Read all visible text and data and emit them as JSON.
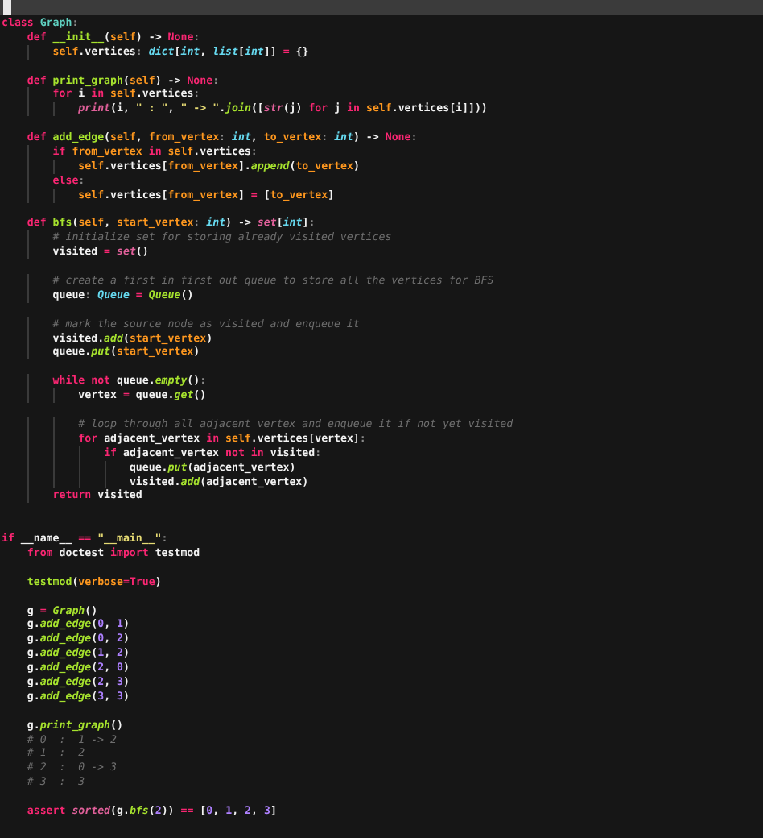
{
  "editor": {
    "lines": [
      {
        "kind": "code",
        "tokens": [
          {
            "text": "class ",
            "kind": "kw"
          },
          {
            "text": "Graph",
            "kind": "cls"
          },
          {
            "text": ":",
            "kind": "punct"
          }
        ]
      },
      {
        "kind": "code",
        "tokens": [
          {
            "text": "    def ",
            "kind": "kw"
          },
          {
            "text": "__init__",
            "kind": "fn"
          },
          {
            "text": "(",
            "kind": "plain"
          },
          {
            "text": "self",
            "kind": "self"
          },
          {
            "text": ") -> ",
            "kind": "plain"
          },
          {
            "text": "None",
            "kind": "kw"
          },
          {
            "text": ":",
            "kind": "punct"
          }
        ]
      },
      {
        "kind": "code",
        "tokens": [
          {
            "text": "        self",
            "kind": "self"
          },
          {
            "text": ".vertices",
            "kind": "plain"
          },
          {
            "text": ": ",
            "kind": "punct"
          },
          {
            "text": "dict",
            "kind": "type"
          },
          {
            "text": "[",
            "kind": "plain"
          },
          {
            "text": "int",
            "kind": "type"
          },
          {
            "text": ", ",
            "kind": "plain"
          },
          {
            "text": "list",
            "kind": "type"
          },
          {
            "text": "[",
            "kind": "plain"
          },
          {
            "text": "int",
            "kind": "type"
          },
          {
            "text": "]] ",
            "kind": "plain"
          },
          {
            "text": "=",
            "kind": "op"
          },
          {
            "text": " {}",
            "kind": "plain"
          }
        ]
      },
      {
        "kind": "blank"
      },
      {
        "kind": "code",
        "tokens": [
          {
            "text": "    def ",
            "kind": "kw"
          },
          {
            "text": "print_graph",
            "kind": "fn"
          },
          {
            "text": "(",
            "kind": "plain"
          },
          {
            "text": "self",
            "kind": "self"
          },
          {
            "text": ") -> ",
            "kind": "plain"
          },
          {
            "text": "None",
            "kind": "kw"
          },
          {
            "text": ":",
            "kind": "punct"
          }
        ]
      },
      {
        "kind": "code",
        "tokens": [
          {
            "text": "        for",
            "kind": "kw"
          },
          {
            "text": " i ",
            "kind": "plain"
          },
          {
            "text": "in ",
            "kind": "kw"
          },
          {
            "text": "self",
            "kind": "self"
          },
          {
            "text": ".vertices",
            "kind": "plain"
          },
          {
            "text": ":",
            "kind": "punct"
          }
        ]
      },
      {
        "kind": "code",
        "tokens": [
          {
            "text": "            print",
            "kind": "builtin"
          },
          {
            "text": "(i, ",
            "kind": "plain"
          },
          {
            "text": "\" : \"",
            "kind": "str"
          },
          {
            "text": ", ",
            "kind": "plain"
          },
          {
            "text": "\" -> \"",
            "kind": "str"
          },
          {
            "text": ".",
            "kind": "plain"
          },
          {
            "text": "join",
            "kind": "call"
          },
          {
            "text": "([",
            "kind": "plain"
          },
          {
            "text": "str",
            "kind": "builtin"
          },
          {
            "text": "(j) ",
            "kind": "plain"
          },
          {
            "text": "for",
            "kind": "kw"
          },
          {
            "text": " j ",
            "kind": "plain"
          },
          {
            "text": "in ",
            "kind": "kw"
          },
          {
            "text": "self",
            "kind": "self"
          },
          {
            "text": ".vertices[i]]))",
            "kind": "plain"
          }
        ]
      },
      {
        "kind": "blank"
      },
      {
        "kind": "code",
        "tokens": [
          {
            "text": "    def ",
            "kind": "kw"
          },
          {
            "text": "add_edge",
            "kind": "fn"
          },
          {
            "text": "(",
            "kind": "plain"
          },
          {
            "text": "self",
            "kind": "self"
          },
          {
            "text": ", ",
            "kind": "plain"
          },
          {
            "text": "from_vertex",
            "kind": "param"
          },
          {
            "text": ": ",
            "kind": "punct"
          },
          {
            "text": "int",
            "kind": "type"
          },
          {
            "text": ", ",
            "kind": "plain"
          },
          {
            "text": "to_vertex",
            "kind": "param"
          },
          {
            "text": ": ",
            "kind": "punct"
          },
          {
            "text": "int",
            "kind": "type"
          },
          {
            "text": ") -> ",
            "kind": "plain"
          },
          {
            "text": "None",
            "kind": "kw"
          },
          {
            "text": ":",
            "kind": "punct"
          }
        ]
      },
      {
        "kind": "code",
        "tokens": [
          {
            "text": "        if ",
            "kind": "kw"
          },
          {
            "text": "from_vertex ",
            "kind": "param"
          },
          {
            "text": "in ",
            "kind": "kw"
          },
          {
            "text": "self",
            "kind": "self"
          },
          {
            "text": ".vertices",
            "kind": "plain"
          },
          {
            "text": ":",
            "kind": "punct"
          }
        ]
      },
      {
        "kind": "code",
        "tokens": [
          {
            "text": "            self",
            "kind": "self"
          },
          {
            "text": ".vertices[",
            "kind": "plain"
          },
          {
            "text": "from_vertex",
            "kind": "param"
          },
          {
            "text": "].",
            "kind": "plain"
          },
          {
            "text": "append",
            "kind": "call"
          },
          {
            "text": "(",
            "kind": "plain"
          },
          {
            "text": "to_vertex",
            "kind": "param"
          },
          {
            "text": ")",
            "kind": "plain"
          }
        ]
      },
      {
        "kind": "code",
        "tokens": [
          {
            "text": "        else",
            "kind": "kw"
          },
          {
            "text": ":",
            "kind": "punct"
          }
        ]
      },
      {
        "kind": "code",
        "tokens": [
          {
            "text": "            self",
            "kind": "self"
          },
          {
            "text": ".vertices[",
            "kind": "plain"
          },
          {
            "text": "from_vertex",
            "kind": "param"
          },
          {
            "text": "] ",
            "kind": "plain"
          },
          {
            "text": "=",
            "kind": "op"
          },
          {
            "text": " [",
            "kind": "plain"
          },
          {
            "text": "to_vertex",
            "kind": "param"
          },
          {
            "text": "]",
            "kind": "plain"
          }
        ]
      },
      {
        "kind": "blank"
      },
      {
        "kind": "code",
        "tokens": [
          {
            "text": "    def ",
            "kind": "kw"
          },
          {
            "text": "bfs",
            "kind": "fn"
          },
          {
            "text": "(",
            "kind": "plain"
          },
          {
            "text": "self",
            "kind": "self"
          },
          {
            "text": ", ",
            "kind": "plain"
          },
          {
            "text": "start_vertex",
            "kind": "param"
          },
          {
            "text": ": ",
            "kind": "punct"
          },
          {
            "text": "int",
            "kind": "type"
          },
          {
            "text": ") -> ",
            "kind": "plain"
          },
          {
            "text": "set",
            "kind": "builtin"
          },
          {
            "text": "[",
            "kind": "plain"
          },
          {
            "text": "int",
            "kind": "type"
          },
          {
            "text": "]",
            "kind": "plain"
          },
          {
            "text": ":",
            "kind": "punct"
          }
        ]
      },
      {
        "kind": "code",
        "tokens": [
          {
            "text": "        # initialize set for storing already visited vertices",
            "kind": "cm"
          }
        ]
      },
      {
        "kind": "code",
        "tokens": [
          {
            "text": "        visited ",
            "kind": "plain"
          },
          {
            "text": "=",
            "kind": "op"
          },
          {
            "text": " set",
            "kind": "builtin"
          },
          {
            "text": "()",
            "kind": "plain"
          }
        ]
      },
      {
        "kind": "blank"
      },
      {
        "kind": "code",
        "tokens": [
          {
            "text": "        # create a first in first out queue to store all the vertices for BFS",
            "kind": "cm"
          }
        ]
      },
      {
        "kind": "code",
        "tokens": [
          {
            "text": "        queue",
            "kind": "plain"
          },
          {
            "text": ": ",
            "kind": "punct"
          },
          {
            "text": "Queue ",
            "kind": "type"
          },
          {
            "text": "=",
            "kind": "op"
          },
          {
            "text": " Queue",
            "kind": "call"
          },
          {
            "text": "()",
            "kind": "plain"
          }
        ]
      },
      {
        "kind": "blank"
      },
      {
        "kind": "code",
        "tokens": [
          {
            "text": "        # mark the source node as visited and enqueue it",
            "kind": "cm"
          }
        ]
      },
      {
        "kind": "code",
        "tokens": [
          {
            "text": "        visited.",
            "kind": "plain"
          },
          {
            "text": "add",
            "kind": "call"
          },
          {
            "text": "(",
            "kind": "plain"
          },
          {
            "text": "start_vertex",
            "kind": "param"
          },
          {
            "text": ")",
            "kind": "plain"
          }
        ]
      },
      {
        "kind": "code",
        "tokens": [
          {
            "text": "        queue.",
            "kind": "plain"
          },
          {
            "text": "put",
            "kind": "call"
          },
          {
            "text": "(",
            "kind": "plain"
          },
          {
            "text": "start_vertex",
            "kind": "param"
          },
          {
            "text": ")",
            "kind": "plain"
          }
        ]
      },
      {
        "kind": "blank"
      },
      {
        "kind": "code",
        "tokens": [
          {
            "text": "        while not",
            "kind": "kw"
          },
          {
            "text": " queue.",
            "kind": "plain"
          },
          {
            "text": "empty",
            "kind": "call"
          },
          {
            "text": "()",
            "kind": "plain"
          },
          {
            "text": ":",
            "kind": "punct"
          }
        ]
      },
      {
        "kind": "code",
        "tokens": [
          {
            "text": "            vertex ",
            "kind": "plain"
          },
          {
            "text": "=",
            "kind": "op"
          },
          {
            "text": " queue.",
            "kind": "plain"
          },
          {
            "text": "get",
            "kind": "call"
          },
          {
            "text": "()",
            "kind": "plain"
          }
        ]
      },
      {
        "kind": "blank"
      },
      {
        "kind": "code",
        "tokens": [
          {
            "text": "            # loop through all adjacent vertex and enqueue it if not yet visited",
            "kind": "cm"
          }
        ]
      },
      {
        "kind": "code",
        "tokens": [
          {
            "text": "            for",
            "kind": "kw"
          },
          {
            "text": " adjacent_vertex ",
            "kind": "plain"
          },
          {
            "text": "in ",
            "kind": "kw"
          },
          {
            "text": "self",
            "kind": "self"
          },
          {
            "text": ".vertices[vertex]",
            "kind": "plain"
          },
          {
            "text": ":",
            "kind": "punct"
          }
        ]
      },
      {
        "kind": "code",
        "tokens": [
          {
            "text": "                if",
            "kind": "kw"
          },
          {
            "text": " adjacent_vertex ",
            "kind": "plain"
          },
          {
            "text": "not in",
            "kind": "kw"
          },
          {
            "text": " visited",
            "kind": "plain"
          },
          {
            "text": ":",
            "kind": "punct"
          }
        ]
      },
      {
        "kind": "code",
        "tokens": [
          {
            "text": "                    queue.",
            "kind": "plain"
          },
          {
            "text": "put",
            "kind": "call"
          },
          {
            "text": "(adjacent_vertex)",
            "kind": "plain"
          }
        ]
      },
      {
        "kind": "code",
        "tokens": [
          {
            "text": "                    visited.",
            "kind": "plain"
          },
          {
            "text": "add",
            "kind": "call"
          },
          {
            "text": "(adjacent_vertex)",
            "kind": "plain"
          }
        ]
      },
      {
        "kind": "code",
        "tokens": [
          {
            "text": "        return",
            "kind": "kw"
          },
          {
            "text": " visited",
            "kind": "plain"
          }
        ]
      },
      {
        "kind": "blank"
      },
      {
        "kind": "blank"
      },
      {
        "kind": "code",
        "tokens": [
          {
            "text": "if",
            "kind": "kw"
          },
          {
            "text": " __name__ ",
            "kind": "plain"
          },
          {
            "text": "==",
            "kind": "op"
          },
          {
            "text": " \"__main__\"",
            "kind": "str"
          },
          {
            "text": ":",
            "kind": "punct"
          }
        ]
      },
      {
        "kind": "code",
        "tokens": [
          {
            "text": "    from",
            "kind": "kw"
          },
          {
            "text": " doctest ",
            "kind": "plain"
          },
          {
            "text": "import",
            "kind": "kw"
          },
          {
            "text": " testmod",
            "kind": "plain"
          }
        ]
      },
      {
        "kind": "blank"
      },
      {
        "kind": "code",
        "tokens": [
          {
            "text": "    testmod",
            "kind": "fn"
          },
          {
            "text": "(",
            "kind": "plain"
          },
          {
            "text": "verbose",
            "kind": "param"
          },
          {
            "text": "=",
            "kind": "op"
          },
          {
            "text": "True",
            "kind": "kw"
          },
          {
            "text": ")",
            "kind": "plain"
          }
        ]
      },
      {
        "kind": "blank"
      },
      {
        "kind": "code",
        "tokens": [
          {
            "text": "    g ",
            "kind": "plain"
          },
          {
            "text": "=",
            "kind": "op"
          },
          {
            "text": " Graph",
            "kind": "call"
          },
          {
            "text": "()",
            "kind": "plain"
          }
        ]
      },
      {
        "kind": "code",
        "tokens": [
          {
            "text": "    g.",
            "kind": "plain"
          },
          {
            "text": "add_edge",
            "kind": "call"
          },
          {
            "text": "(",
            "kind": "plain"
          },
          {
            "text": "0",
            "kind": "num"
          },
          {
            "text": ", ",
            "kind": "plain"
          },
          {
            "text": "1",
            "kind": "num"
          },
          {
            "text": ")",
            "kind": "plain"
          }
        ]
      },
      {
        "kind": "code",
        "tokens": [
          {
            "text": "    g.",
            "kind": "plain"
          },
          {
            "text": "add_edge",
            "kind": "call"
          },
          {
            "text": "(",
            "kind": "plain"
          },
          {
            "text": "0",
            "kind": "num"
          },
          {
            "text": ", ",
            "kind": "plain"
          },
          {
            "text": "2",
            "kind": "num"
          },
          {
            "text": ")",
            "kind": "plain"
          }
        ]
      },
      {
        "kind": "code",
        "tokens": [
          {
            "text": "    g.",
            "kind": "plain"
          },
          {
            "text": "add_edge",
            "kind": "call"
          },
          {
            "text": "(",
            "kind": "plain"
          },
          {
            "text": "1",
            "kind": "num"
          },
          {
            "text": ", ",
            "kind": "plain"
          },
          {
            "text": "2",
            "kind": "num"
          },
          {
            "text": ")",
            "kind": "plain"
          }
        ]
      },
      {
        "kind": "code",
        "tokens": [
          {
            "text": "    g.",
            "kind": "plain"
          },
          {
            "text": "add_edge",
            "kind": "call"
          },
          {
            "text": "(",
            "kind": "plain"
          },
          {
            "text": "2",
            "kind": "num"
          },
          {
            "text": ", ",
            "kind": "plain"
          },
          {
            "text": "0",
            "kind": "num"
          },
          {
            "text": ")",
            "kind": "plain"
          }
        ]
      },
      {
        "kind": "code",
        "tokens": [
          {
            "text": "    g.",
            "kind": "plain"
          },
          {
            "text": "add_edge",
            "kind": "call"
          },
          {
            "text": "(",
            "kind": "plain"
          },
          {
            "text": "2",
            "kind": "num"
          },
          {
            "text": ", ",
            "kind": "plain"
          },
          {
            "text": "3",
            "kind": "num"
          },
          {
            "text": ")",
            "kind": "plain"
          }
        ]
      },
      {
        "kind": "code",
        "tokens": [
          {
            "text": "    g.",
            "kind": "plain"
          },
          {
            "text": "add_edge",
            "kind": "call"
          },
          {
            "text": "(",
            "kind": "plain"
          },
          {
            "text": "3",
            "kind": "num"
          },
          {
            "text": ", ",
            "kind": "plain"
          },
          {
            "text": "3",
            "kind": "num"
          },
          {
            "text": ")",
            "kind": "plain"
          }
        ]
      },
      {
        "kind": "blank"
      },
      {
        "kind": "code",
        "tokens": [
          {
            "text": "    g.",
            "kind": "plain"
          },
          {
            "text": "print_graph",
            "kind": "call"
          },
          {
            "text": "()",
            "kind": "plain"
          }
        ]
      },
      {
        "kind": "code",
        "tokens": [
          {
            "text": "    # 0  :  1 -> 2",
            "kind": "cm"
          }
        ]
      },
      {
        "kind": "code",
        "tokens": [
          {
            "text": "    # 1  :  2",
            "kind": "cm"
          }
        ]
      },
      {
        "kind": "code",
        "tokens": [
          {
            "text": "    # 2  :  0 -> 3",
            "kind": "cm"
          }
        ]
      },
      {
        "kind": "code",
        "tokens": [
          {
            "text": "    # 3  :  3",
            "kind": "cm"
          }
        ]
      },
      {
        "kind": "blank"
      },
      {
        "kind": "code",
        "tokens": [
          {
            "text": "    assert",
            "kind": "kw"
          },
          {
            "text": " sorted",
            "kind": "builtin"
          },
          {
            "text": "(g.",
            "kind": "plain"
          },
          {
            "text": "bfs",
            "kind": "call"
          },
          {
            "text": "(",
            "kind": "plain"
          },
          {
            "text": "2",
            "kind": "num"
          },
          {
            "text": ")) ",
            "kind": "plain"
          },
          {
            "text": "==",
            "kind": "op"
          },
          {
            "text": " [",
            "kind": "plain"
          },
          {
            "text": "0",
            "kind": "num"
          },
          {
            "text": ", ",
            "kind": "plain"
          },
          {
            "text": "1",
            "kind": "num"
          },
          {
            "text": ", ",
            "kind": "plain"
          },
          {
            "text": "2",
            "kind": "num"
          },
          {
            "text": ", ",
            "kind": "plain"
          },
          {
            "text": "3",
            "kind": "num"
          },
          {
            "text": "]",
            "kind": "plain"
          }
        ]
      }
    ]
  }
}
